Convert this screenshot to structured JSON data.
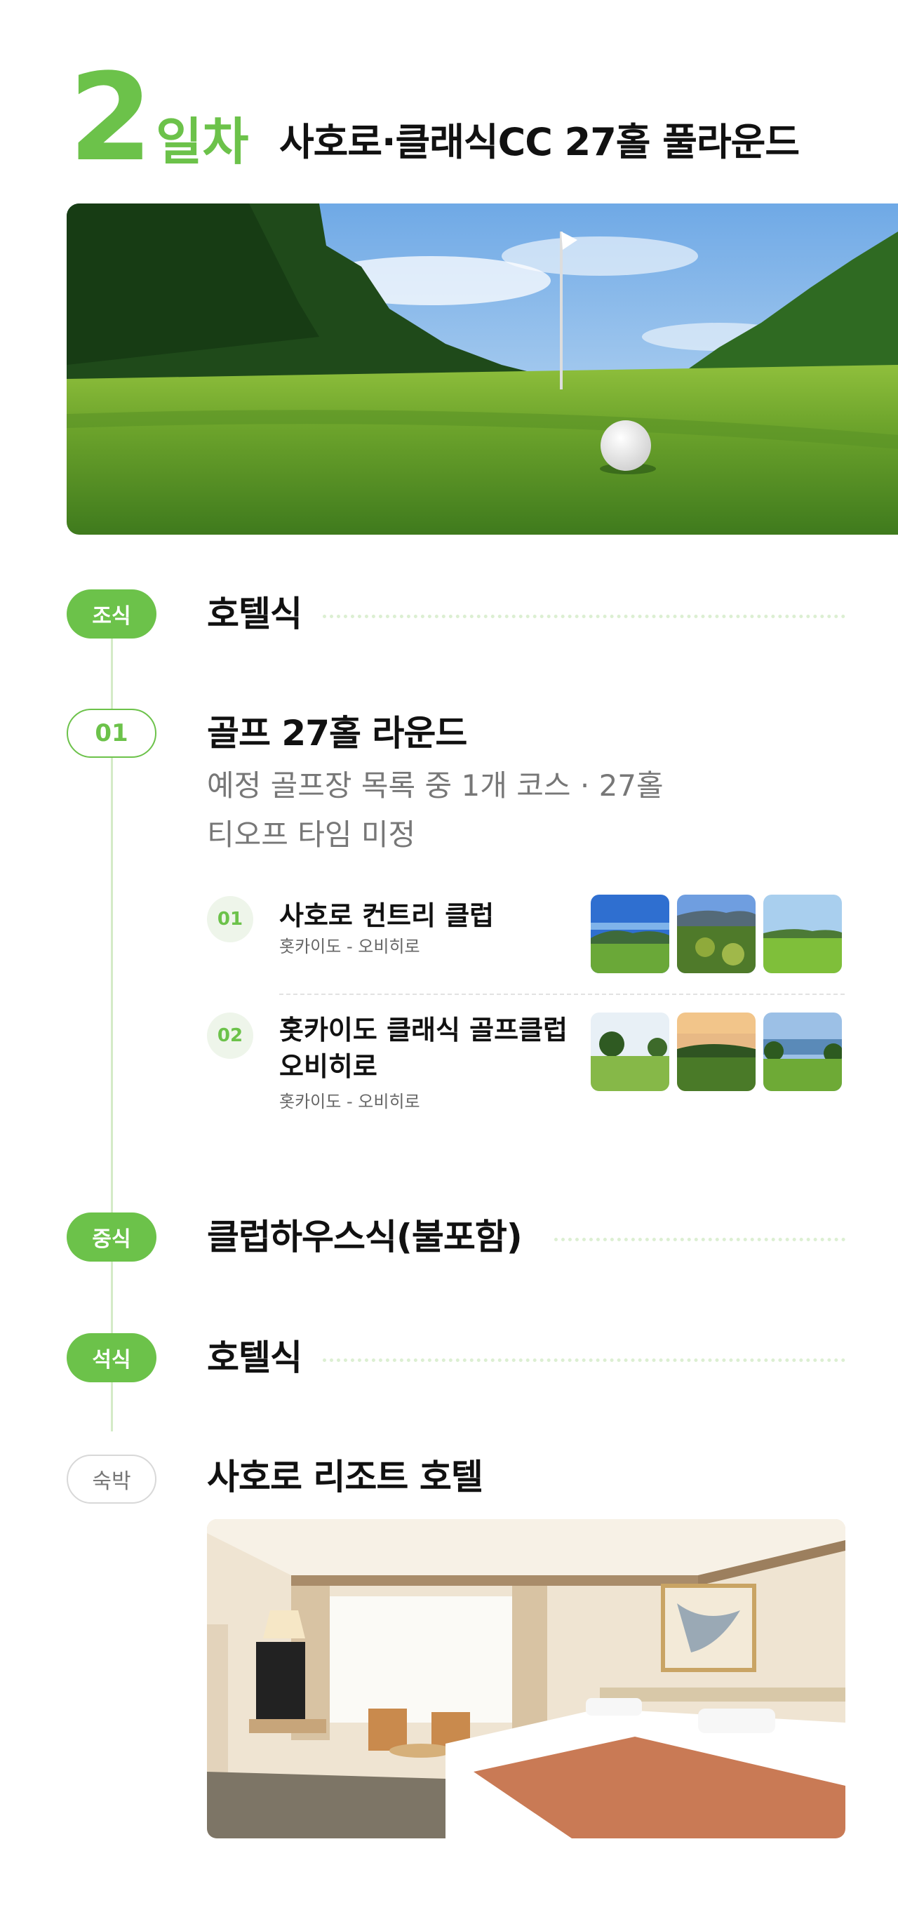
{
  "day": {
    "number": "2",
    "unit": "일차",
    "title": "사호로·클래식CC 27홀 풀라운드"
  },
  "schedule": [
    {
      "badge": "조식",
      "title": "호텔식"
    },
    {
      "badge": "01",
      "title": "골프 27홀 라운드",
      "details": [
        "예정 골프장 목록 중 1개 코스 · 27홀",
        "티오프 타임 미정"
      ],
      "courses": [
        {
          "num": "01",
          "name": "사호로 컨트리 클럽",
          "location": "홋카이도 - 오비히로"
        },
        {
          "num": "02",
          "name_line1": "홋카이도 클래식 골프클럽",
          "name_line2": "오비히로",
          "location": "홋카이도 - 오비히로"
        }
      ]
    },
    {
      "badge": "중식",
      "title": "클럽하우스식(불포함)"
    },
    {
      "badge": "석식",
      "title": "호텔식"
    },
    {
      "badge": "숙박",
      "title": "사호로 리조트 호텔"
    }
  ],
  "colors": {
    "accent": "#6cc24a",
    "line": "#d4ebc7",
    "muted": "#777777"
  }
}
